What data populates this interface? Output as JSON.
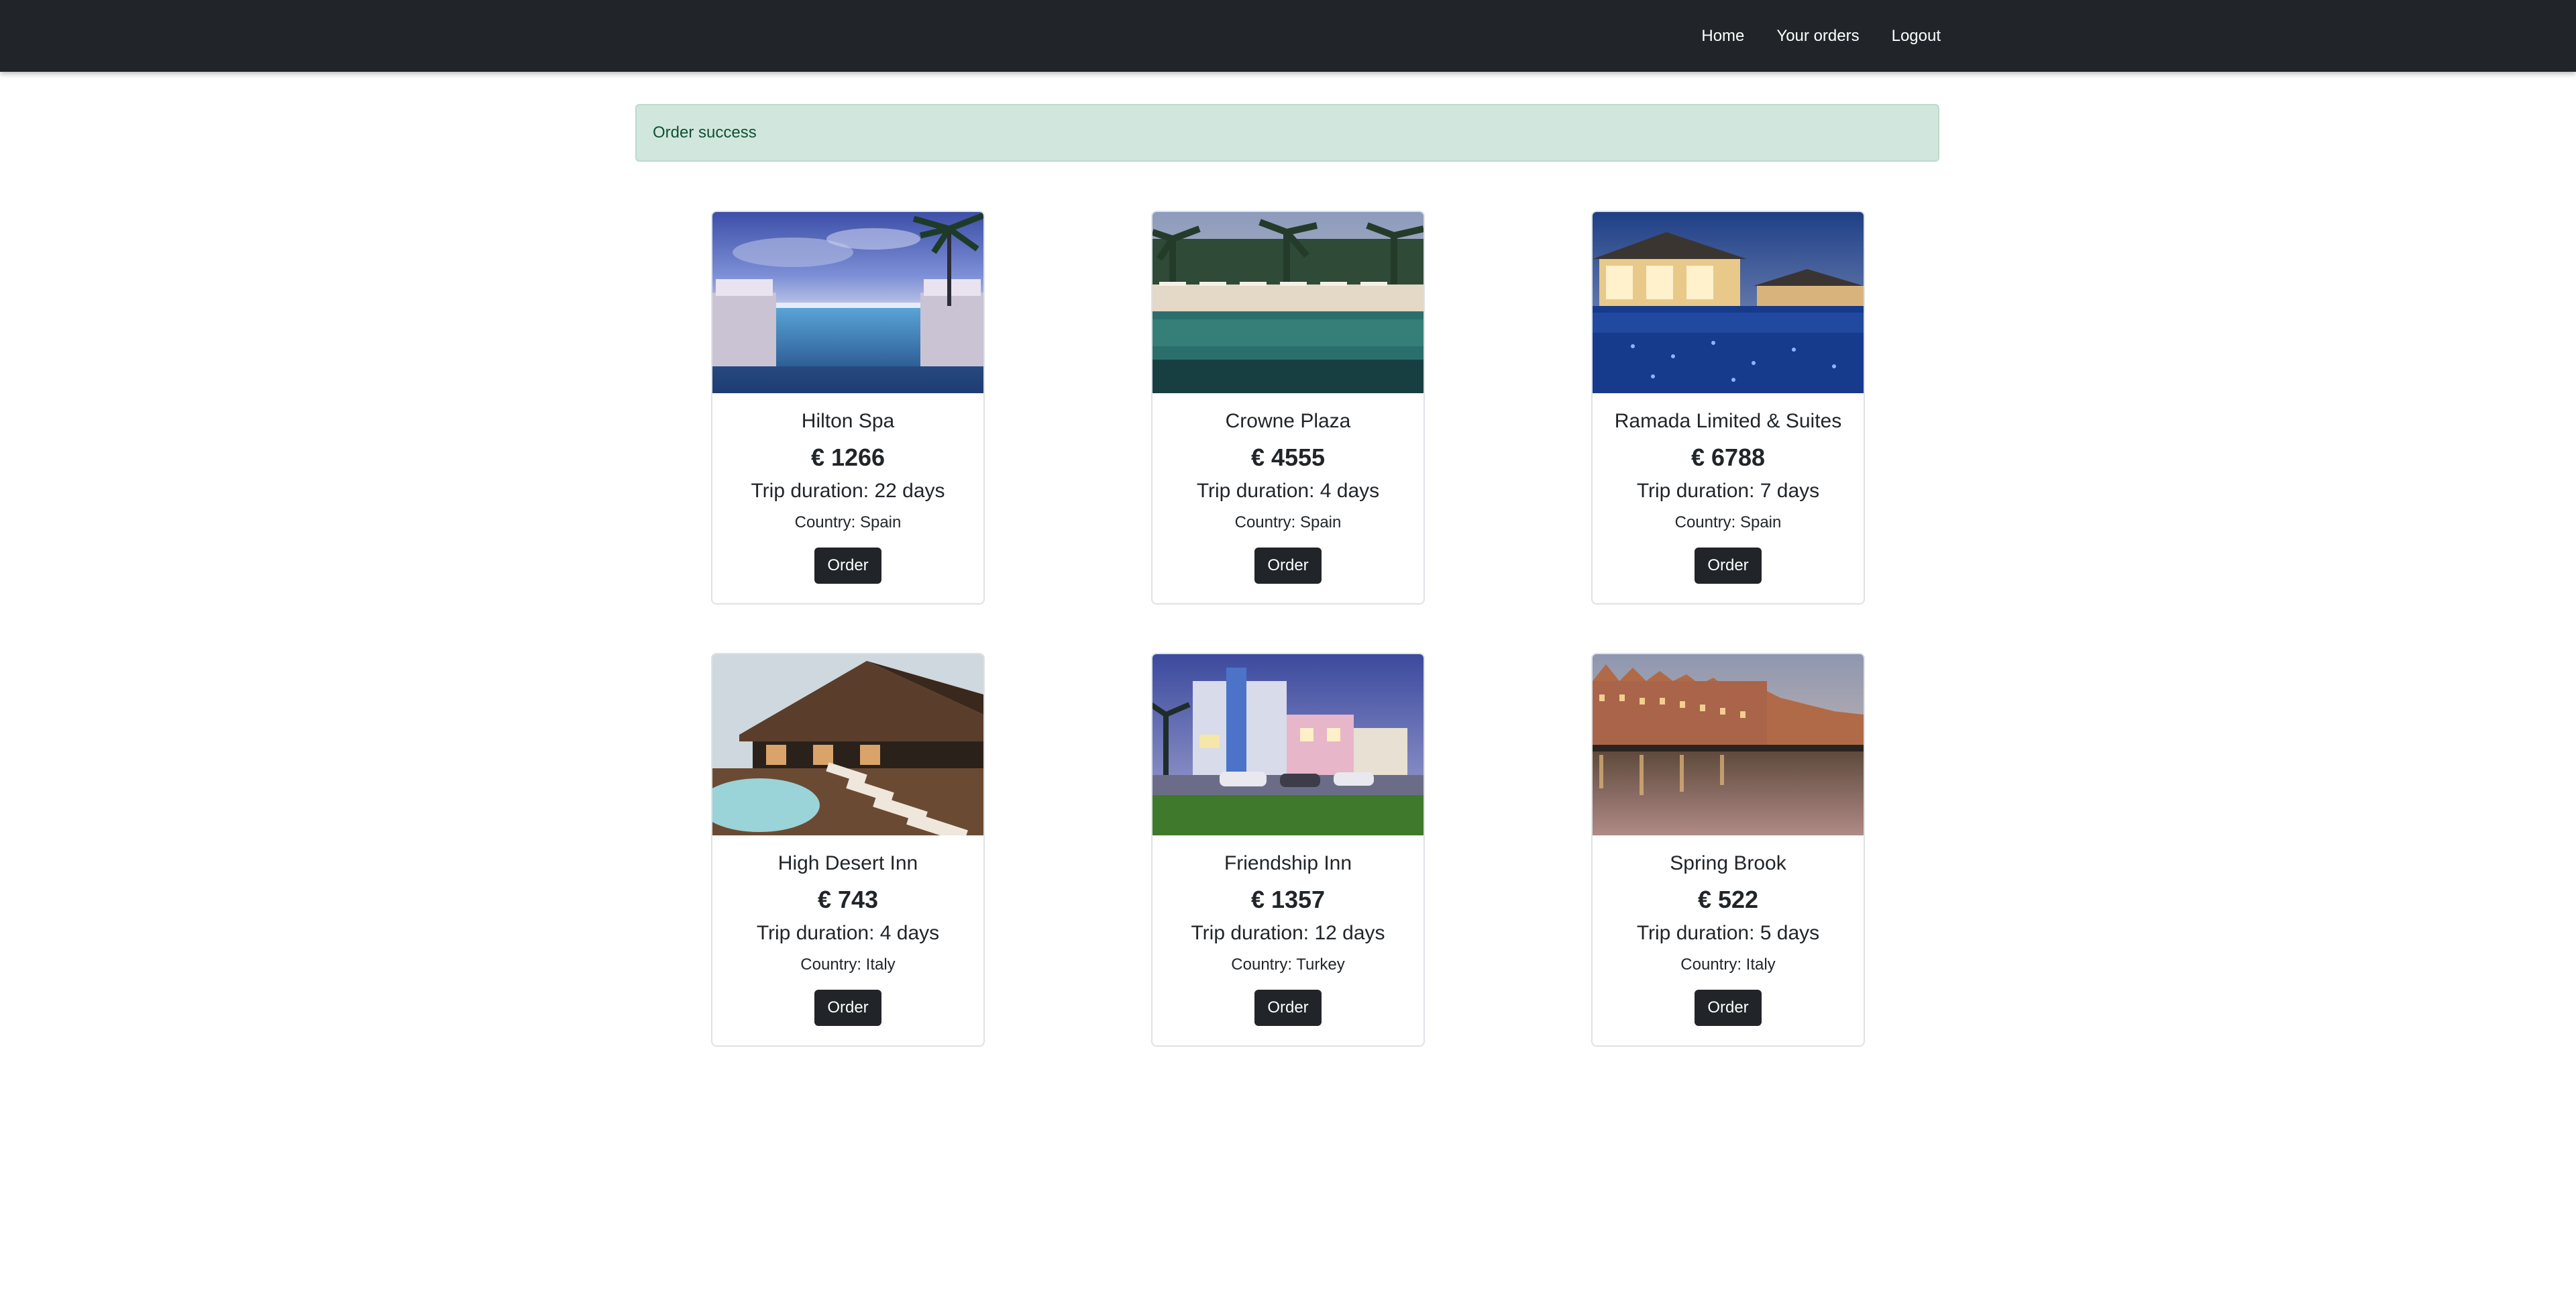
{
  "nav": {
    "links": [
      "Home",
      "Your orders",
      "Logout"
    ]
  },
  "alert": {
    "message": "Order success"
  },
  "hotels": [
    {
      "name": "Hilton Spa",
      "price": "€ 1266",
      "duration": "Trip duration: 22 days",
      "country": "Country: Spain",
      "button": "Order"
    },
    {
      "name": "Crowne Plaza",
      "price": "€ 4555",
      "duration": "Trip duration: 4 days",
      "country": "Country: Spain",
      "button": "Order"
    },
    {
      "name": "Ramada Limited & Suites",
      "price": "€ 6788",
      "duration": "Trip duration: 7 days",
      "country": "Country: Spain",
      "button": "Order"
    },
    {
      "name": "High Desert Inn",
      "price": "€ 743",
      "duration": "Trip duration: 4 days",
      "country": "Country: Italy",
      "button": "Order"
    },
    {
      "name": "Friendship Inn",
      "price": "€ 1357",
      "duration": "Trip duration: 12 days",
      "country": "Country: Turkey",
      "button": "Order"
    },
    {
      "name": "Spring Brook",
      "price": "€ 522",
      "duration": "Trip duration: 5 days",
      "country": "Country: Italy",
      "button": "Order"
    }
  ]
}
